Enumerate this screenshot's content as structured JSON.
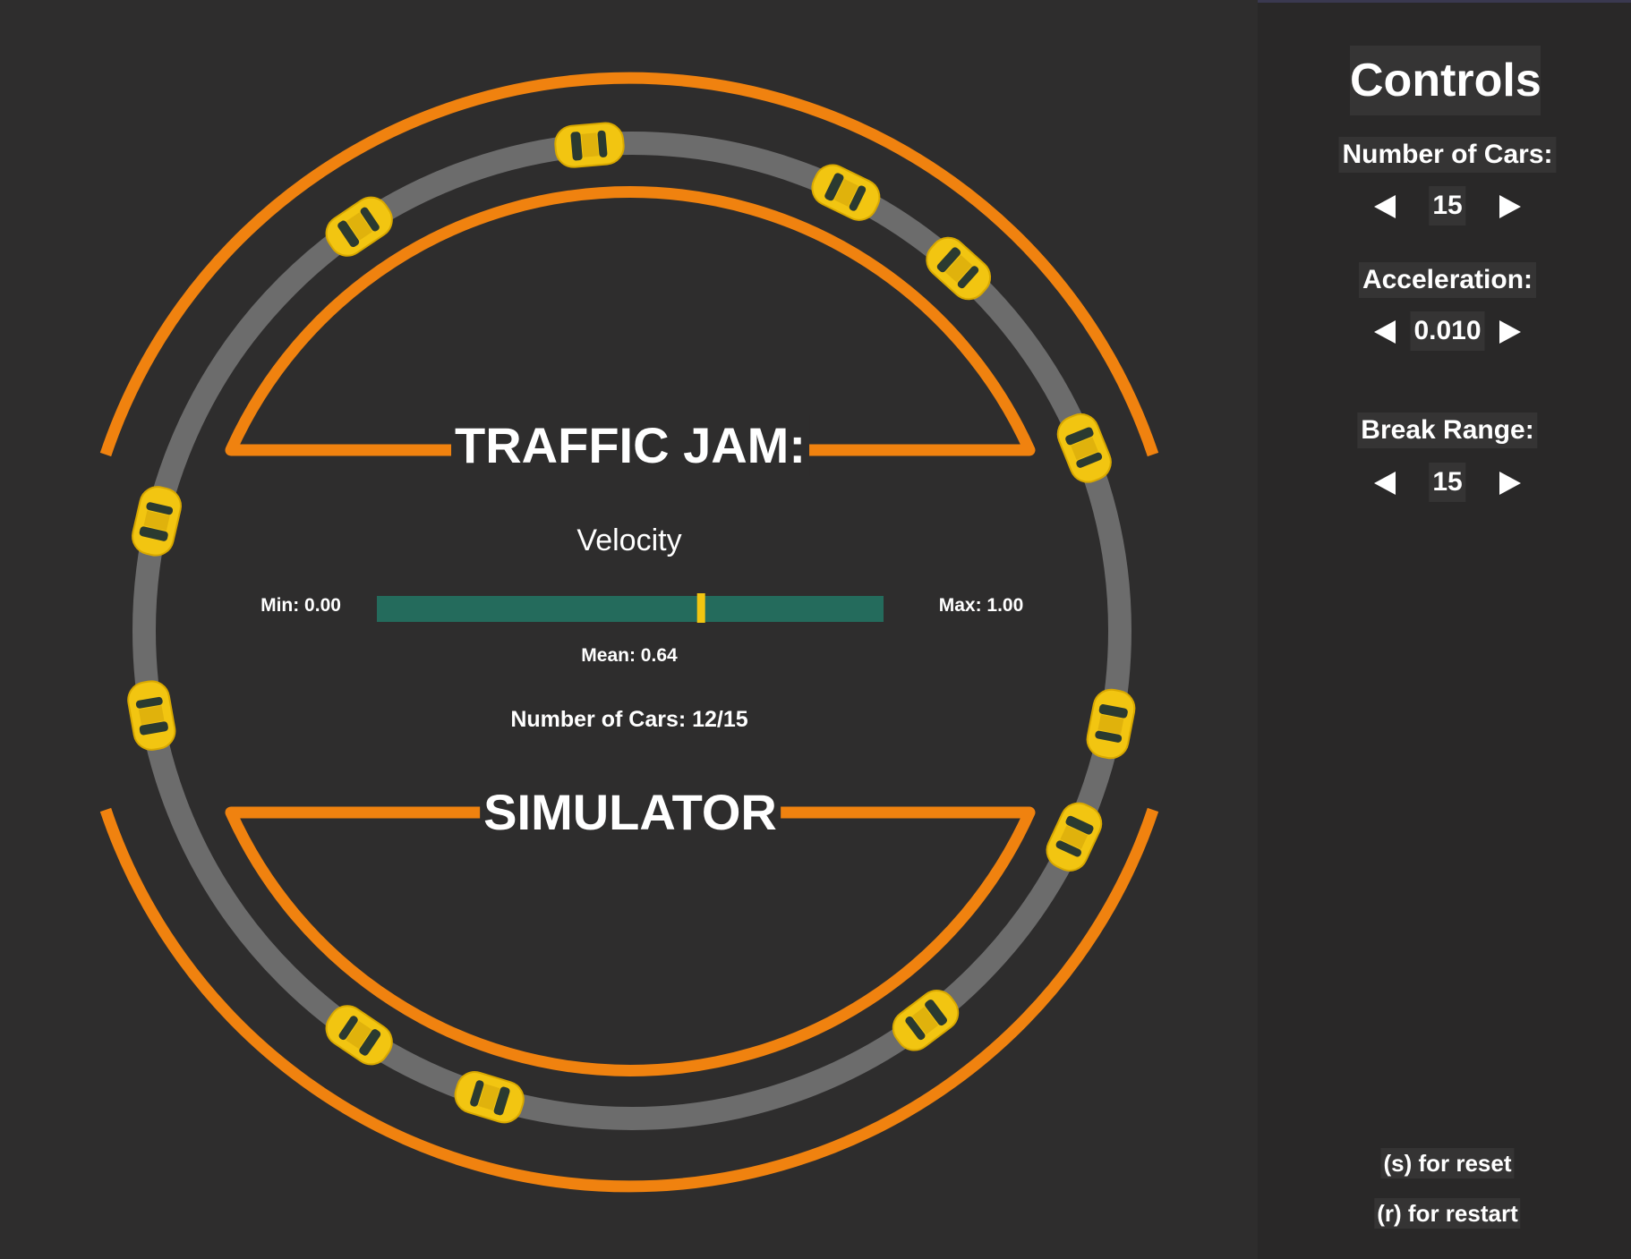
{
  "title": {
    "line1": "TRAFFIC JAM:",
    "line2": "SIMULATOR"
  },
  "velocity": {
    "label": "Velocity",
    "min_label": "Min: 0.00",
    "max_label": "Max: 1.00",
    "mean_label": "Mean: 0.64",
    "min": 0.0,
    "max": 1.0,
    "mean": 0.64
  },
  "cars_status": {
    "label": "Number of Cars: 12/15",
    "shown": 12,
    "total": 15
  },
  "controls": {
    "title": "Controls",
    "number_of_cars": {
      "label": "Number of Cars:",
      "value": "15"
    },
    "acceleration": {
      "label": "Acceleration:",
      "value": "0.010"
    },
    "break_range": {
      "label": "Break Range:",
      "value": "15"
    }
  },
  "hints": {
    "reset": "(s) for reset",
    "restart": "(r) for restart"
  },
  "colors": {
    "background": "#2e2d2d",
    "panel": "#292828",
    "track": "#6c6c6c",
    "accent_orange": "#f0820f",
    "car_yellow": "#f2c511",
    "velocity_bar": "#246b5c",
    "mean_marker": "#f2c511"
  },
  "car_track_angles_deg": [
    -95,
    -64,
    -48,
    -22,
    11,
    25,
    53,
    107,
    124,
    170,
    193,
    236
  ]
}
